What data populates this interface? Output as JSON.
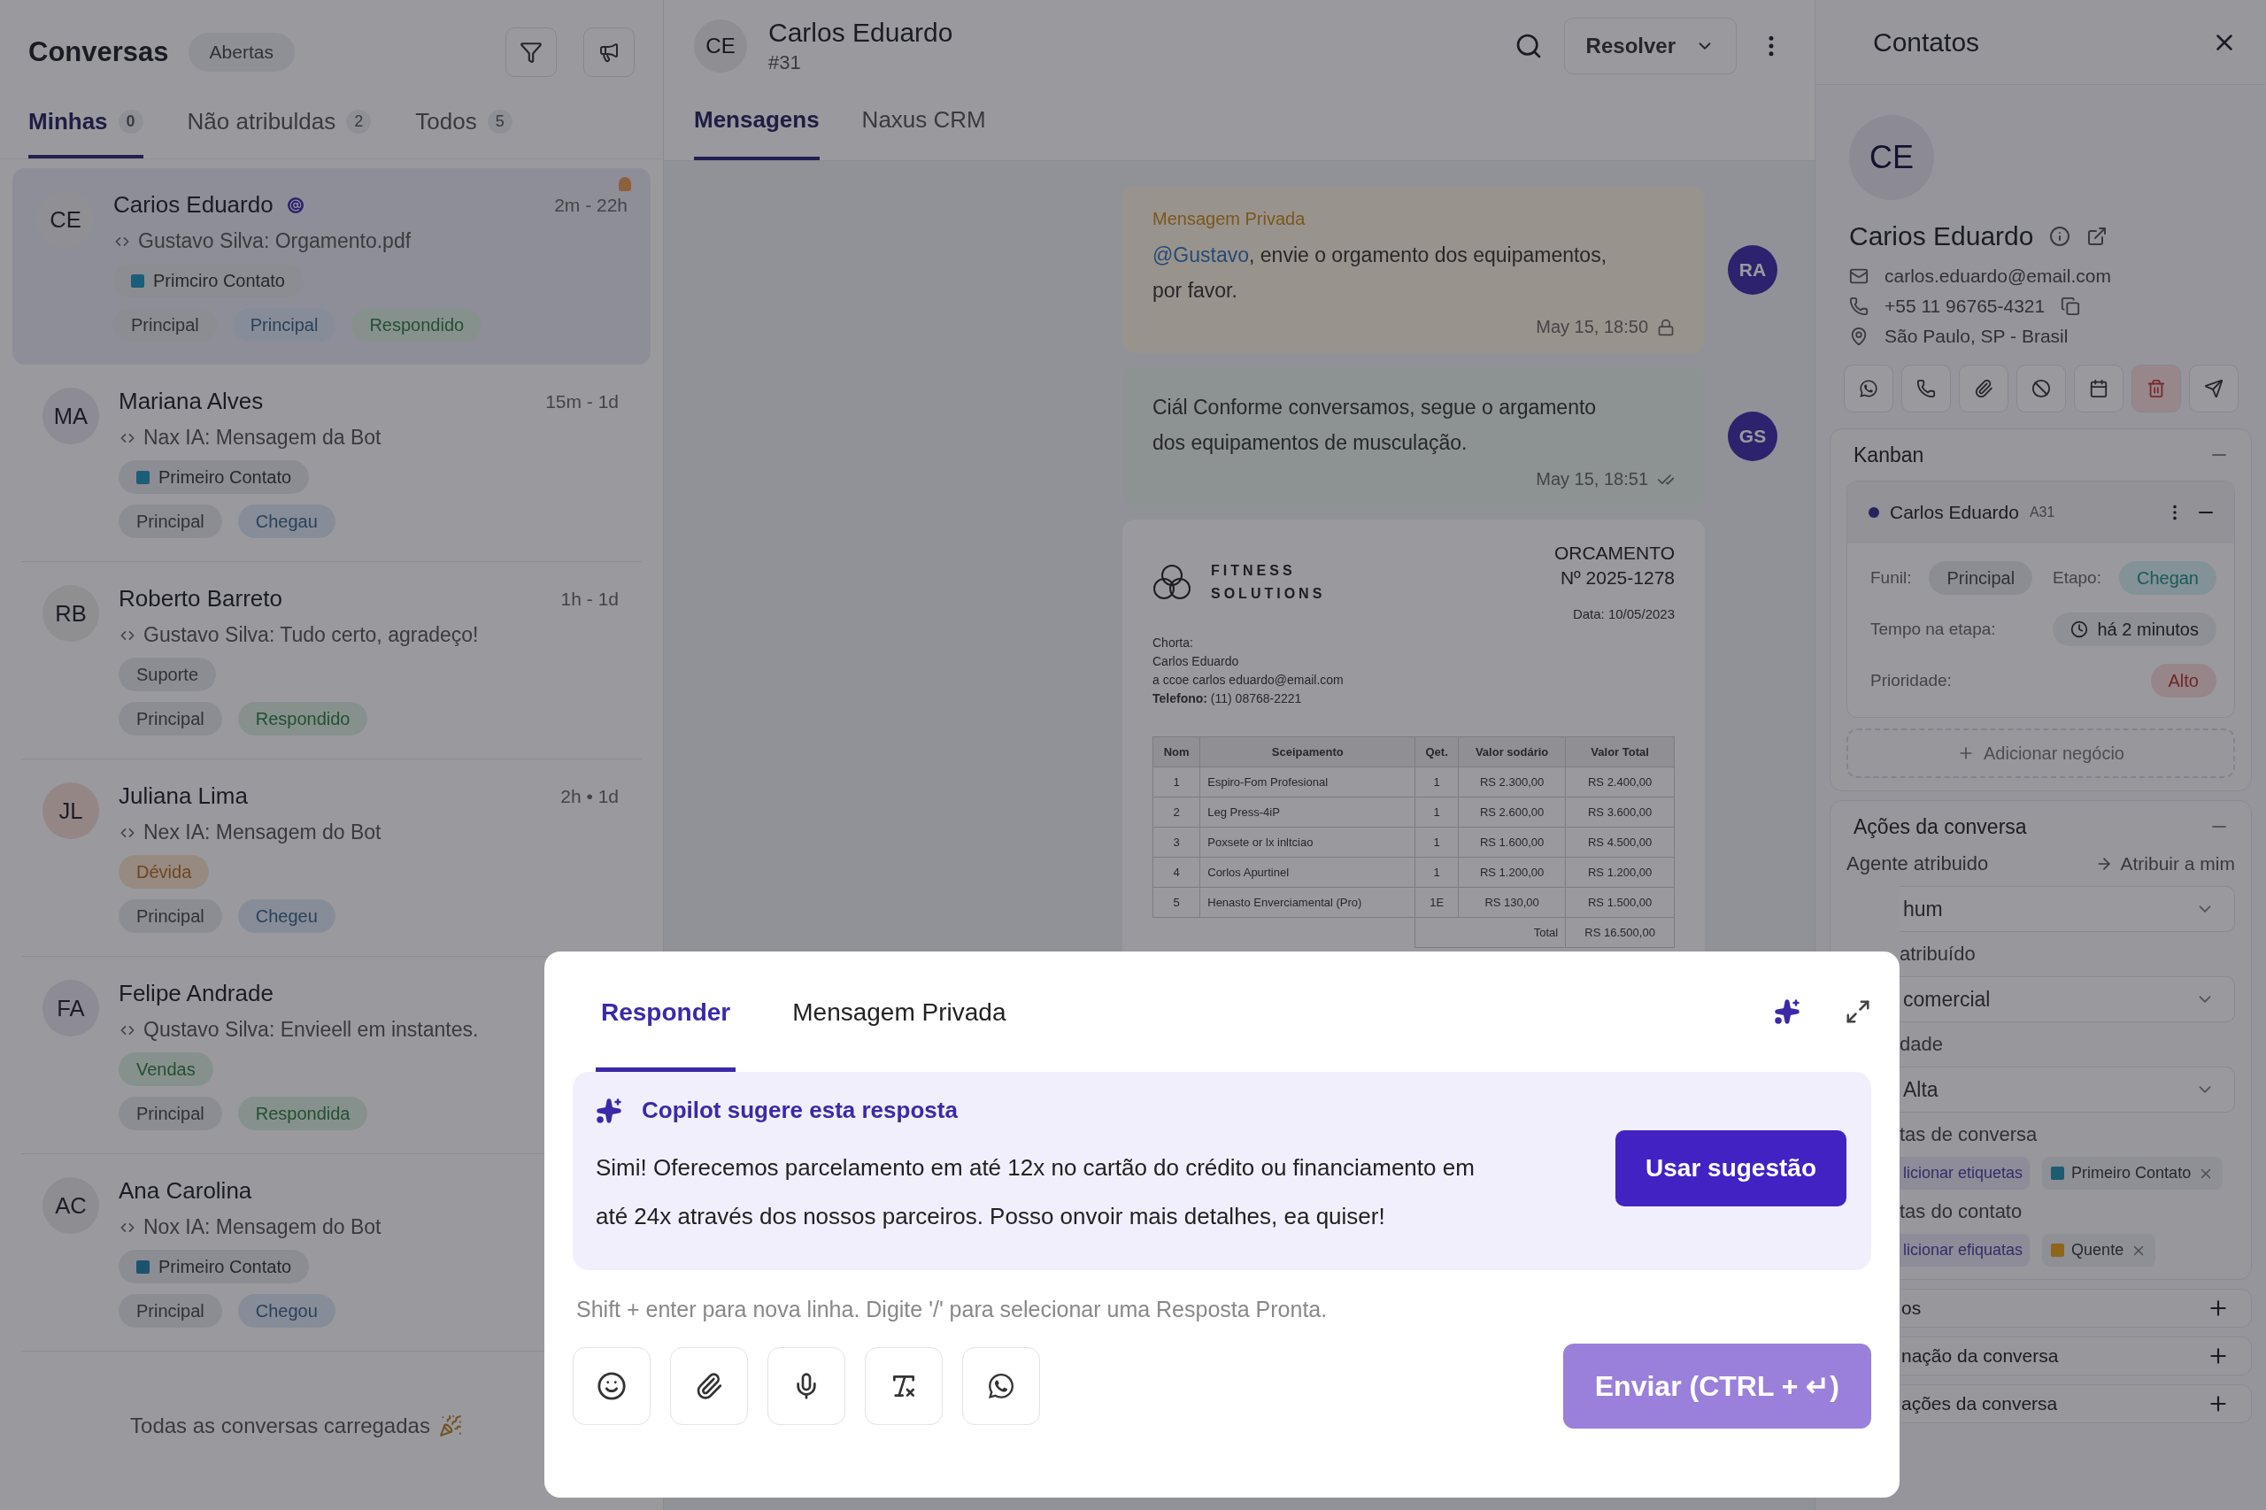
{
  "conversations": {
    "title": "Conversas",
    "status_filter": "Abertas",
    "tabs": [
      {
        "label": "Minhas",
        "count": "0",
        "selected": true
      },
      {
        "label": "Não atribuldas",
        "count": "2",
        "selected": false
      },
      {
        "label": "Todos",
        "count": "5",
        "selected": false
      }
    ],
    "items": [
      {
        "initials": "CE",
        "color": "#909094",
        "name": "Carios Eduardo",
        "time": "2m - 22h",
        "preview": "Gustavo Silva: Orgamento.pdf",
        "selected": true,
        "assigned_badge": true,
        "unread_dot": true,
        "labels": [
          {
            "text": "Primciro Contato",
            "kind": "tag",
            "color": "#1c5d78"
          }
        ],
        "chips": [
          {
            "text": "Principal",
            "kind": "grey"
          },
          {
            "text": "Principal",
            "kind": "blue"
          },
          {
            "text": "Respondido",
            "kind": "green"
          }
        ]
      },
      {
        "initials": "MA",
        "color": "#8d8b93",
        "name": "Mariana Alves",
        "time": "15m - 1d",
        "preview": "Nax IA: Mensagem da Bot",
        "selected": false,
        "assigned_badge": false,
        "unread_dot": false,
        "labels": [
          {
            "text": "Primeiro Contato",
            "kind": "tag",
            "color": "#1c5d78"
          }
        ],
        "chips": [
          {
            "text": "Principal",
            "kind": "grey"
          },
          {
            "text": "Chegau",
            "kind": "blue"
          }
        ]
      },
      {
        "initials": "RB",
        "color": "#8f8f92",
        "name": "Roberto Barreto",
        "time": "1h - 1d",
        "preview": "Gustavo Silva: Tudo certo, agradeço!",
        "selected": false,
        "assigned_badge": false,
        "unread_dot": false,
        "labels": [
          {
            "text": "Suporte",
            "kind": "grey"
          }
        ],
        "chips": [
          {
            "text": "Principal",
            "kind": "grey"
          },
          {
            "text": "Respondido",
            "kind": "green"
          }
        ]
      },
      {
        "initials": "JL",
        "color": "#958686",
        "name": "Juliana Lima",
        "time": "2h • 1d",
        "preview": "Nex IA: Mensagem do Bot",
        "selected": false,
        "assigned_badge": false,
        "unread_dot": false,
        "labels": [
          {
            "text": "Dévida",
            "kind": "orange"
          }
        ],
        "chips": [
          {
            "text": "Principal",
            "kind": "grey"
          },
          {
            "text": "Chegeu",
            "kind": "blue"
          }
        ]
      },
      {
        "initials": "FA",
        "color": "#8d8b93",
        "name": "Felipe Andrade",
        "preview": "Qustavo Silva: Envieell em instantes.",
        "selected": false,
        "assigned_badge": false,
        "unread_dot": false,
        "labels": [
          {
            "text": "Vendas",
            "kind": "green"
          }
        ],
        "chips": [
          {
            "text": "Principal",
            "kind": "grey"
          },
          {
            "text": "Respondida",
            "kind": "green"
          }
        ]
      },
      {
        "initials": "AC",
        "color": "#8e8d92",
        "name": "Ana Carolina",
        "preview": "Nox IA: Mensagem do Bot",
        "selected": false,
        "assigned_badge": false,
        "unread_dot": false,
        "labels": [
          {
            "text": "Primeiro Contato",
            "kind": "tag",
            "color": "#1c526e"
          }
        ],
        "chips": [
          {
            "text": "Principal",
            "kind": "grey"
          },
          {
            "text": "Chegou",
            "kind": "blue"
          }
        ]
      }
    ],
    "footer": "Todas as conversas carregadas"
  },
  "chat": {
    "initials": "CE",
    "name": "Carlos Eduardo",
    "number": "#31",
    "resolve_button": "Resolver",
    "tabs": [
      {
        "label": "Mensagens",
        "selected": true
      },
      {
        "label": "Naxus CRM",
        "selected": false
      }
    ],
    "messages": [
      {
        "kind": "private",
        "label": "Mensagem Privada",
        "mention": "@Gustavo",
        "text": ", envie o orgamento dos equipamentos, por favor.",
        "time": "May 15, 18:50",
        "avatar": "RA"
      },
      {
        "kind": "outgoing",
        "text": "Ciál Conforme conversamos, segue o argamento dos equipamentos de musculação.",
        "time": "May 15, 18:51",
        "avatar": "GS"
      },
      {
        "kind": "document",
        "brand": [
          "FITNESS",
          "SOLUTIONS"
        ],
        "doc_title": "ORCAMENTO",
        "doc_number": "Nº 2025-1278",
        "date": "Data: 10/05/2023",
        "client_lines": [
          "Chorta:",
          "Carlos Eduardo",
          "a ccoe carlos eduardo@email.com",
          "**Telefono:** (11) 08768-2221"
        ],
        "columns": [
          "Nom",
          "Sceipamento",
          "Qet.",
          "Valor sodário",
          "Valor Total"
        ],
        "rows": [
          [
            "1",
            "Espiro-Fom Profesional",
            "1",
            "RS 2.300,00",
            "RS 2.400,00"
          ],
          [
            "2",
            "Leg Press-4iP",
            "1",
            "RS 2.600,00",
            "RS 3.600,00"
          ],
          [
            "3",
            "Poxsete or lx inltciao",
            "1",
            "RS 1.600,00",
            "RS 4.500,00"
          ],
          [
            "4",
            "Corlos Apurtinel",
            "1",
            "RS 1.200,00",
            "RS 1.200,00"
          ],
          [
            "5",
            "Henasto Enverciamental (Pro)",
            "1E",
            "RS 130,00",
            "RS 1.500,00"
          ]
        ],
        "total_label": "Total",
        "total_value": "RS 16.500,00"
      }
    ]
  },
  "contact": {
    "title": "Contatos",
    "initials": "CE",
    "name": "Carios Eduardo",
    "email": "carlos.eduardo@email.com",
    "phone": "+55 11 96765-4321",
    "location": "São Paulo, SP - Brasil",
    "actions": [
      {
        "kind": "whatsapp"
      },
      {
        "kind": "phone"
      },
      {
        "kind": "attach"
      },
      {
        "kind": "block"
      },
      {
        "kind": "calendar"
      },
      {
        "kind": "delete"
      },
      {
        "kind": "send"
      }
    ]
  },
  "kanban": {
    "title": "Kanban",
    "expanded": true,
    "card": {
      "color": "#25235b",
      "name": "Carlos Eduardo",
      "code": "A31",
      "rows": [
        [
          {
            "label": "Funil:",
            "value": "Principal",
            "kind": "grey"
          },
          {
            "label": "Etapo:",
            "value": "Chegan",
            "kind": "teal"
          }
        ],
        [
          {
            "label": "Tempo na etapa:",
            "value": "há 2 minutos",
            "kind": "time"
          }
        ],
        [
          {
            "label": "Prioridade:",
            "value": "Alto",
            "kind": "red"
          }
        ]
      ]
    },
    "add_button": "Adicionar negócio"
  },
  "conversation_actions": {
    "title": "Ações da conversa",
    "expanded": true,
    "assign_label": "Agente atribuido",
    "assign_link": "Atribuir a mim",
    "fields": [
      {
        "kind": "select",
        "value": "hum"
      },
      {
        "kind": "label",
        "text": "atribuído"
      },
      {
        "kind": "select",
        "value": "comercial"
      },
      {
        "kind": "label",
        "text": "dade"
      },
      {
        "kind": "select",
        "value": "Alta"
      },
      {
        "kind": "label",
        "text": "tas de conversa"
      },
      {
        "kind": "tags",
        "add": "licionar etiquetas",
        "tags": [
          {
            "text": "Primeiro Contato",
            "color": "#1c5b70"
          }
        ]
      },
      {
        "kind": "label",
        "text": "tas do contato"
      },
      {
        "kind": "tags",
        "add": "licionar efiquatas",
        "tags": [
          {
            "text": "Quente",
            "color": "#8d661a"
          }
        ]
      }
    ]
  },
  "more_sections": [
    {
      "title": "os",
      "expanded": false
    },
    {
      "title": "nação da conversa",
      "expanded": false
    },
    {
      "title": "ações da conversa",
      "expanded": false
    }
  ],
  "composer": {
    "tabs": [
      {
        "label": "Responder",
        "selected": true
      },
      {
        "label": "Mensagem Privada",
        "selected": false
      }
    ],
    "suggestion_title": "Copilot sugere esta resposta",
    "suggestion_text": "Simi! Oferecemos parcelamento em até 12x no cartão do crédito ou financiamento em até 24x através dos nossos parceiros. Posso onvoir mais detalhes, ea quiser!",
    "use_button": "Usar sugestão",
    "placeholder": "Shift + enter para nova linha. Digite '/' para selecionar uma Resposta Pronta.",
    "tools": [
      {
        "kind": "emoji"
      },
      {
        "kind": "attach"
      },
      {
        "kind": "mic"
      },
      {
        "kind": "clear_format"
      },
      {
        "kind": "whatsapp"
      }
    ],
    "send_button": "Enviar (CTRL + ↵)",
    "send_disabled": true
  }
}
